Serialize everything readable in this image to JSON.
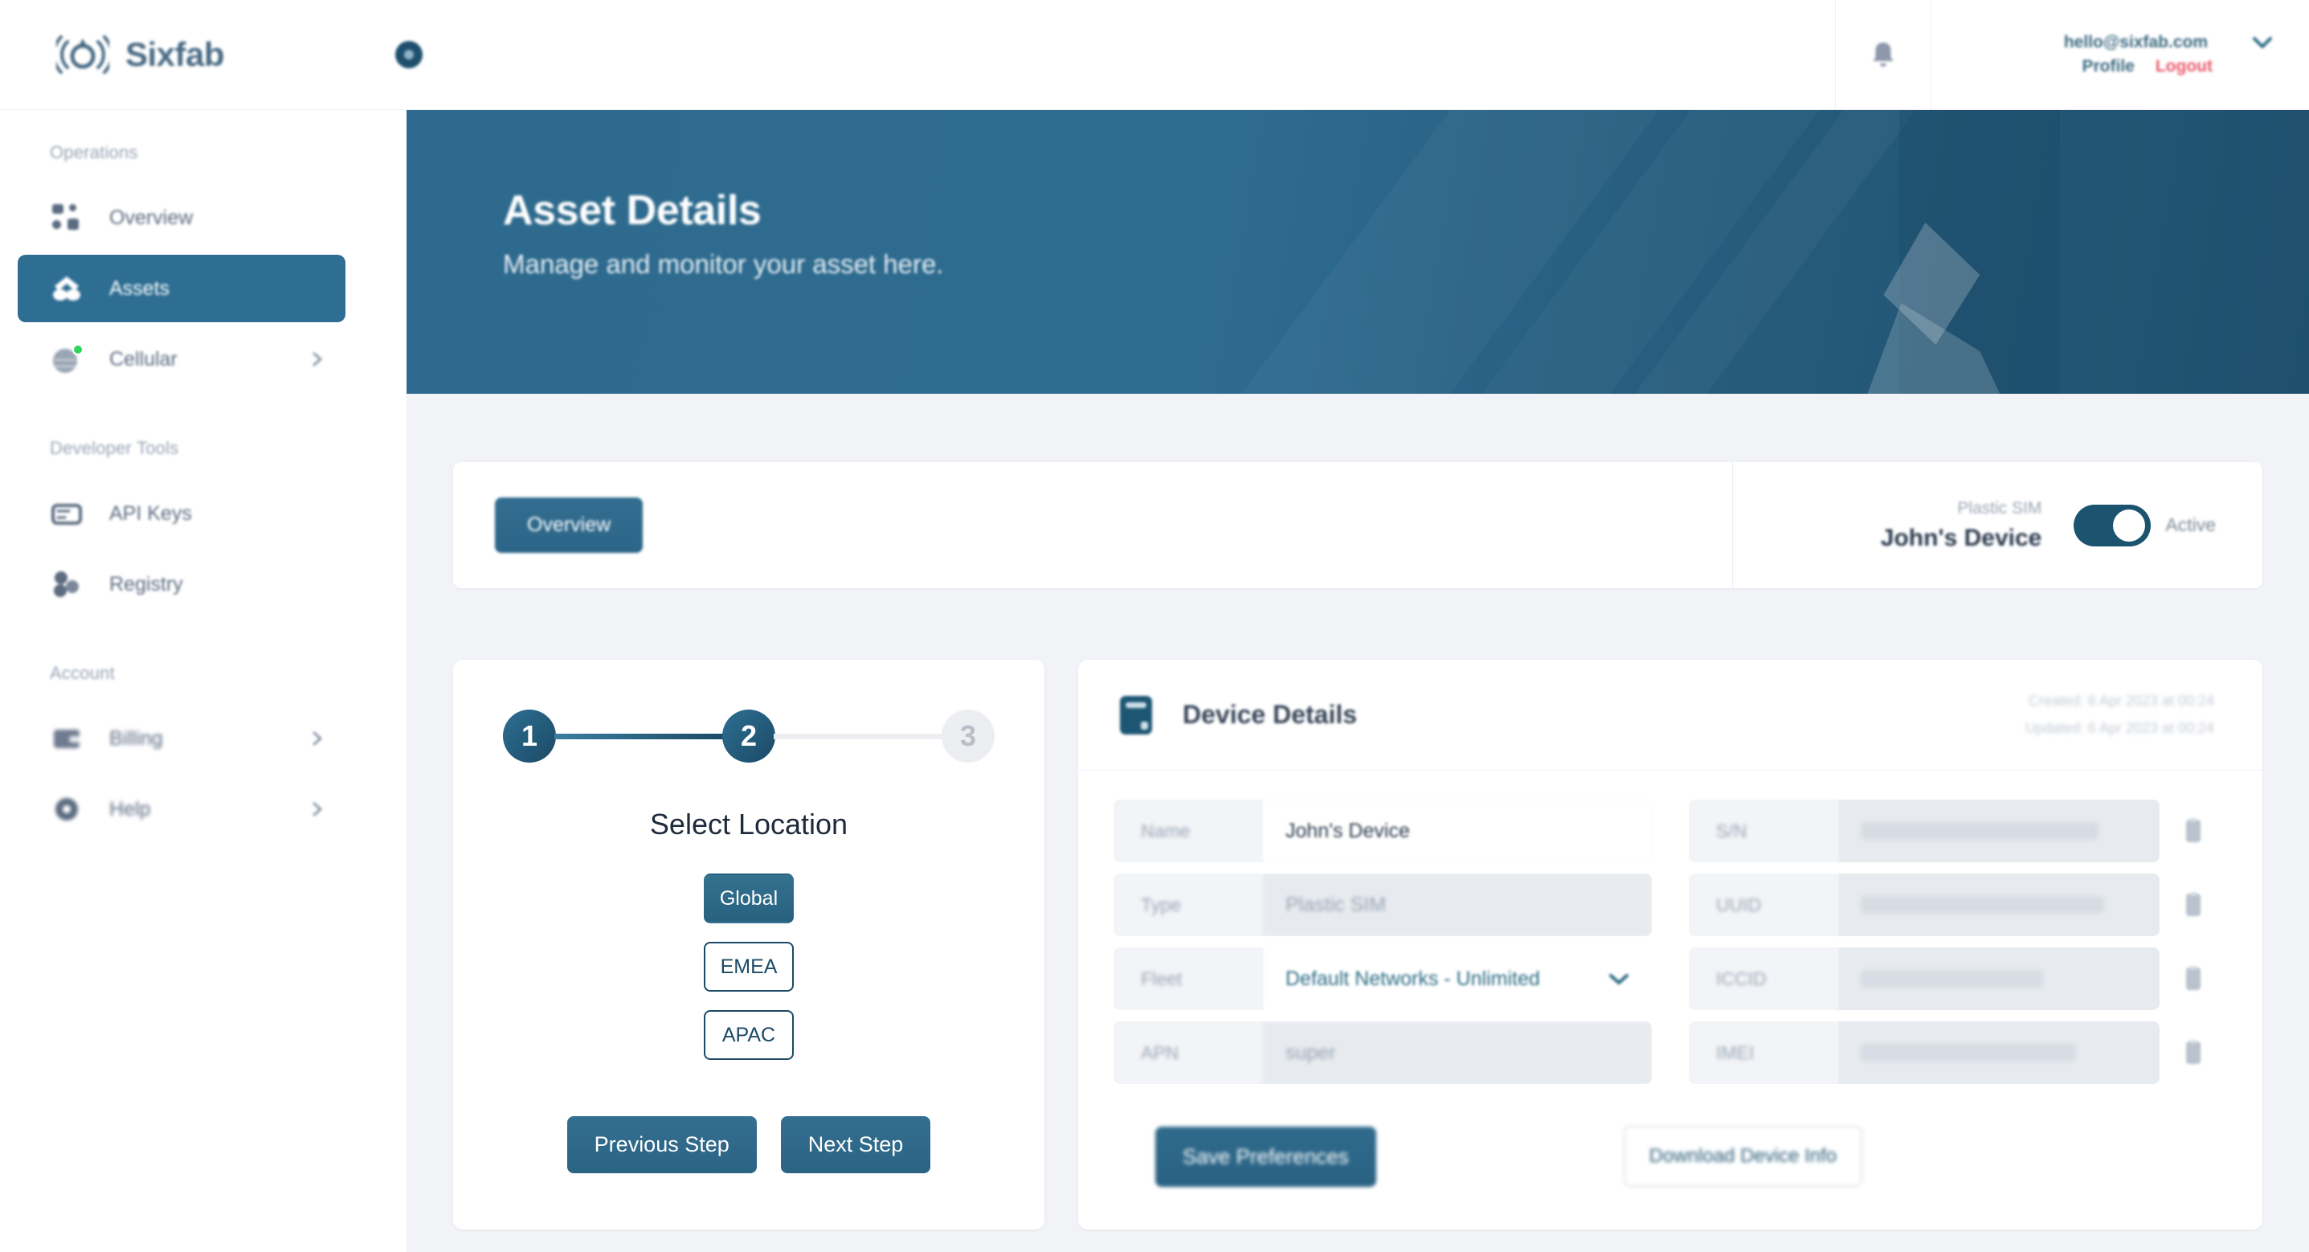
{
  "brand": {
    "name": "Sixfab",
    "logo_icon": "signal-waves-icon",
    "orb_icon": "status-orb-icon"
  },
  "topbar": {
    "notifications_icon": "bell-icon",
    "account_email": "hello@sixfab.com",
    "account_chevron_icon": "chevron-down-icon",
    "profile_label": "Profile",
    "logout_label": "Logout"
  },
  "sidebar": {
    "groups": [
      {
        "label": "Operations",
        "items": [
          {
            "label": "Overview",
            "icon": "grid-icon",
            "active": false,
            "chevron": false,
            "dot": false
          },
          {
            "label": "Assets",
            "icon": "layers-icon",
            "active": true,
            "chevron": false,
            "dot": false
          },
          {
            "label": "Cellular",
            "icon": "sim-cloud-icon",
            "active": false,
            "chevron": true,
            "dot": true
          }
        ]
      },
      {
        "label": "Developer Tools",
        "items": [
          {
            "label": "API Keys",
            "icon": "key-card-icon",
            "active": false,
            "chevron": false,
            "dot": false
          },
          {
            "label": "Registry",
            "icon": "registry-icon",
            "active": false,
            "chevron": false,
            "dot": false
          }
        ]
      },
      {
        "label": "Account",
        "items": [
          {
            "label": "Billing",
            "icon": "wallet-icon",
            "active": false,
            "chevron": true,
            "dot": false
          },
          {
            "label": "Help",
            "icon": "gear-icon",
            "active": false,
            "chevron": true,
            "dot": false
          }
        ]
      }
    ]
  },
  "banner": {
    "title": "Asset Details",
    "subtitle": "Manage and monitor your asset here."
  },
  "tabcard": {
    "overview_tab": "Overview",
    "sim_type": "Plastic SIM",
    "sim_name": "John's Device",
    "toggle_state_label": "Active",
    "toggle_on": true
  },
  "wizard": {
    "steps": [
      {
        "number": "1",
        "state": "done"
      },
      {
        "number": "2",
        "state": "current"
      },
      {
        "number": "3",
        "state": "upcoming"
      }
    ],
    "title": "Select Location",
    "locations": [
      {
        "label": "Global",
        "selected": true
      },
      {
        "label": "EMEA",
        "selected": false
      },
      {
        "label": "APAC",
        "selected": false
      }
    ],
    "previous_label": "Previous Step",
    "next_label": "Next Step"
  },
  "device": {
    "icon": "sim-device-icon",
    "title": "Device Details",
    "created": "Created: 6 Apr 2023 at 00:24",
    "updated": "Updated: 6 Apr 2023 at 00:24",
    "left_fields": [
      {
        "label": "Name",
        "value": "John's Device",
        "kind": "text"
      },
      {
        "label": "Type",
        "value": "Plastic SIM",
        "kind": "disabled"
      },
      {
        "label": "Fleet",
        "value": "Default Networks - Unlimited",
        "kind": "select"
      },
      {
        "label": "APN",
        "value": "super",
        "kind": "disabled"
      }
    ],
    "right_fields": [
      {
        "label": "S/N",
        "value": "",
        "kind": "redacted",
        "copy_icon": "copy-icon",
        "bar": 86
      },
      {
        "label": "UUID",
        "value": "",
        "kind": "redacted",
        "copy_icon": "copy-icon",
        "bar": 88
      },
      {
        "label": "ICCID",
        "value": "",
        "kind": "redacted",
        "copy_icon": "copy-icon",
        "bar": 66
      },
      {
        "label": "IMEI",
        "value": "",
        "kind": "redacted",
        "copy_icon": "copy-icon",
        "bar": 78
      }
    ],
    "save_label": "Save Preferences",
    "download_label": "Download Device Info"
  },
  "colors": {
    "accent": "#2e6e93",
    "accent_dark": "#1c4a66",
    "danger": "#e8596b",
    "muted": "#9aa5b5",
    "status_green": "#2fd65a",
    "page_bg": "#f1f3f6"
  }
}
